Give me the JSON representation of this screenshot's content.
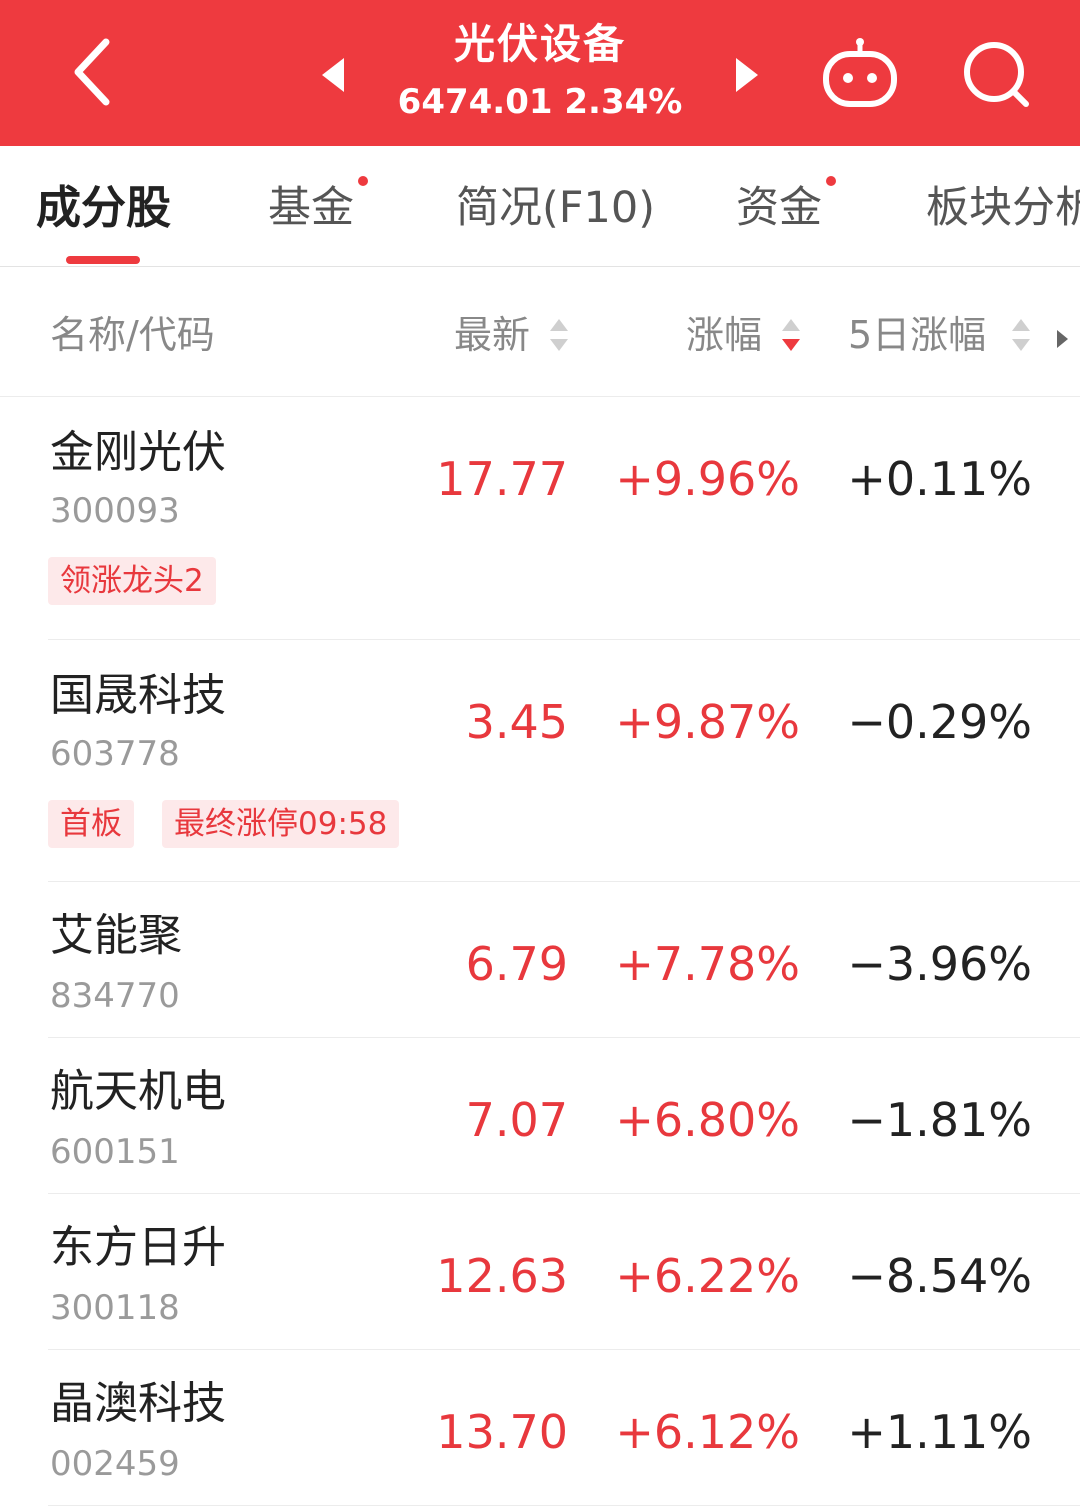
{
  "header": {
    "title": "光伏设备",
    "subtitle": "6474.01 2.34%"
  },
  "tabs": [
    {
      "label": "成分股"
    },
    {
      "label": "基金"
    },
    {
      "label": "简况(F10)"
    },
    {
      "label": "资金"
    },
    {
      "label": "板块分析"
    }
  ],
  "columns": {
    "name": "名称/代码",
    "price": "最新",
    "change": "涨幅",
    "change5": "5日涨幅"
  },
  "rows": [
    {
      "name": "金刚光伏",
      "code": "300093",
      "price": "17.77",
      "change": "+9.96%",
      "change5": "+0.11%",
      "tags": [
        "领涨龙头2"
      ]
    },
    {
      "name": "国晟科技",
      "code": "603778",
      "price": "3.45",
      "change": "+9.87%",
      "change5": "−0.29%",
      "tags": [
        "首板",
        "最终涨停09:58"
      ]
    },
    {
      "name": "艾能聚",
      "code": "834770",
      "price": "6.79",
      "change": "+7.78%",
      "change5": "−3.96%",
      "tags": []
    },
    {
      "name": "航天机电",
      "code": "600151",
      "price": "7.07",
      "change": "+6.80%",
      "change5": "−1.81%",
      "tags": []
    },
    {
      "name": "东方日升",
      "code": "300118",
      "price": "12.63",
      "change": "+6.22%",
      "change5": "−8.54%",
      "tags": []
    },
    {
      "name": "晶澳科技",
      "code": "002459",
      "price": "13.70",
      "change": "+6.12%",
      "change5": "+1.11%",
      "tags": []
    }
  ],
  "colors": {
    "brand_red": "#ee3a3f",
    "up_red": "#e8383d",
    "tag_bg": "#fde9ea"
  },
  "icons": [
    "back-icon",
    "prev-arrow-icon",
    "next-arrow-icon",
    "robot-icon",
    "search-icon",
    "sort-icon",
    "more-arrow-icon"
  ]
}
